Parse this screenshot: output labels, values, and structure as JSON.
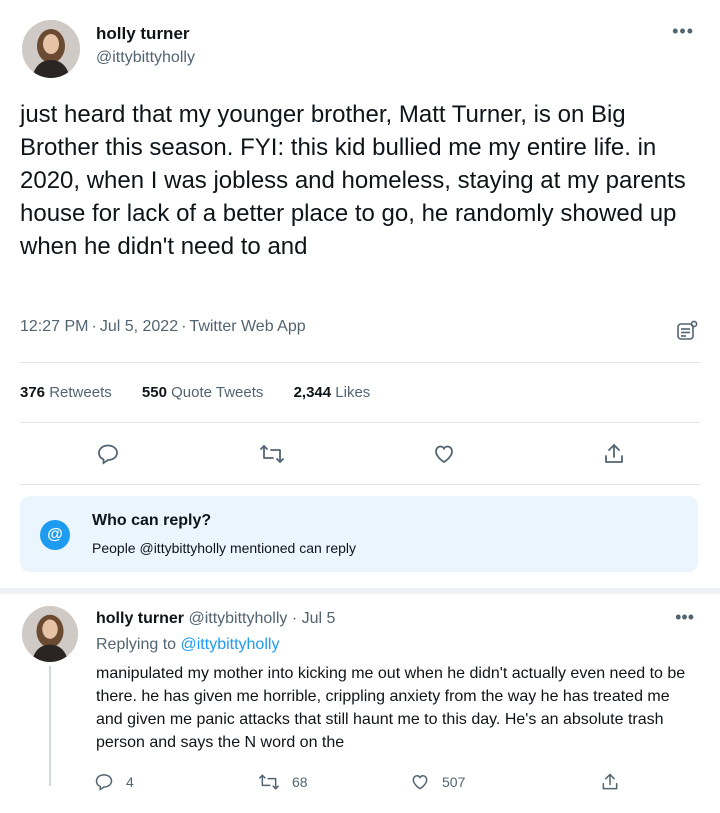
{
  "tweet": {
    "author_name": "holly turner",
    "author_handle": "@ittybittyholly",
    "text": "just heard that my younger brother, Matt Turner, is on Big Brother this season. FYI: this kid bullied me my entire life. in 2020, when I was jobless and homeless, staying at my parents house for lack of a better place to go, he randomly showed up when he didn't need to and",
    "time": "12:27 PM",
    "date": "Jul 5, 2022",
    "source": "Twitter Web App",
    "retweets": "376",
    "retweets_label": "Retweets",
    "quotes": "550",
    "quotes_label": "Quote Tweets",
    "likes": "2,344",
    "likes_label": "Likes"
  },
  "who_can_reply": {
    "title": "Who can reply?",
    "subtitle": "People @ittybittyholly mentioned can reply"
  },
  "reply": {
    "author_name": "holly turner",
    "author_handle": "@ittybittyholly",
    "date": "Jul 5",
    "replying_prefix": "Replying to",
    "replying_to": "@ittybittyholly",
    "text": "manipulated my mother into kicking me out when he didn't actually even need to be there. he has given me horrible, crippling anxiety from the way he has treated me and given me panic attacks that still haunt me to this day. He's an absolute trash person and says the N word on the",
    "reply_count": "4",
    "retweet_count": "68",
    "like_count": "507"
  },
  "icons": [
    "more-icon",
    "label-icon",
    "reply-icon",
    "retweet-icon",
    "like-icon",
    "share-icon",
    "at-icon"
  ],
  "colors": {
    "accent": "#1d9bf0",
    "muted": "#536471",
    "text": "#0f1419",
    "panel": "#ebf5fd"
  }
}
